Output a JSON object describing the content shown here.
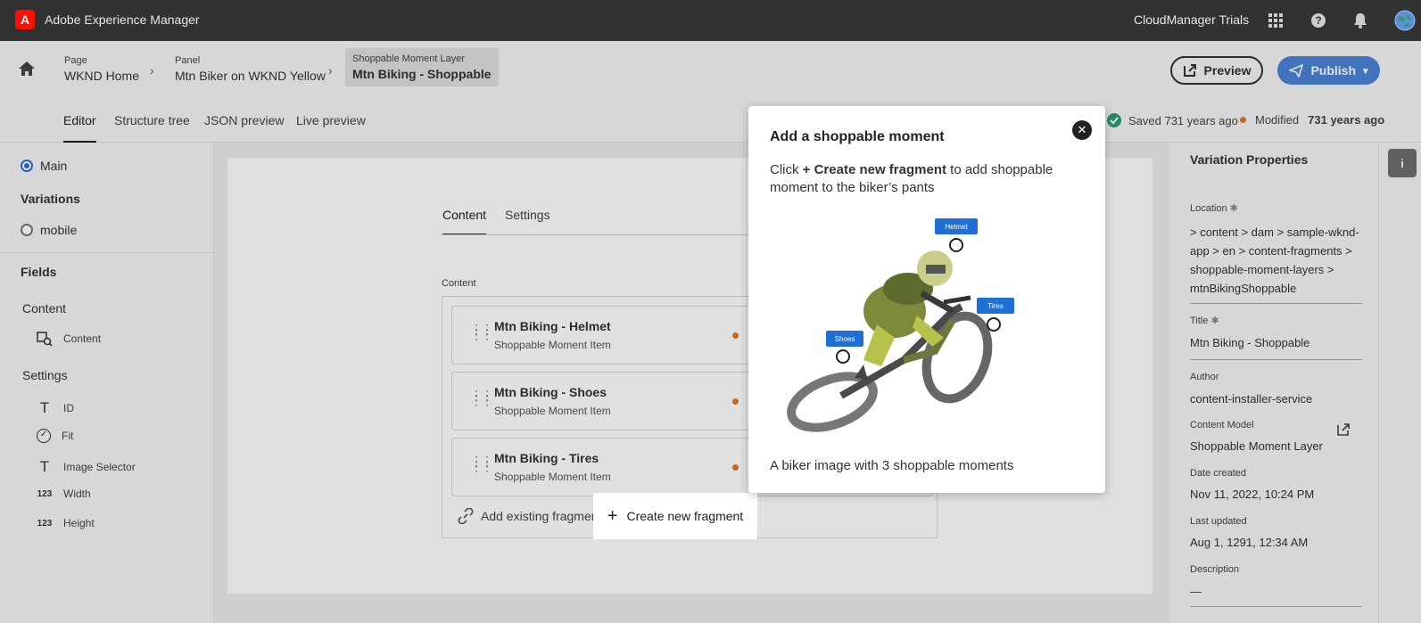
{
  "topbar": {
    "app_title": "Adobe Experience Manager",
    "logo_letter": "A",
    "org": "CloudManager Trials",
    "icons": [
      "apps-grid-icon",
      "help-icon",
      "bell-icon",
      "globe-avatar-icon"
    ]
  },
  "breadcrumbs": [
    {
      "type": "Page",
      "name": "WKND Home"
    },
    {
      "type": "Panel",
      "name": "Mtn Biker on WKND Yellow"
    },
    {
      "type": "Shoppable Moment Layer",
      "name": "Mtn Biking - Shoppable"
    }
  ],
  "actions": {
    "preview_label": "Preview",
    "publish_label": "Publish"
  },
  "tabs": [
    "Editor",
    "Structure tree",
    "JSON preview",
    "Live preview"
  ],
  "status": {
    "saved": "Saved 731 years ago",
    "modified_label": "Modified",
    "modified_value": "731 years ago"
  },
  "left_panel": {
    "main_label": "Main",
    "variations_heading": "Variations",
    "variation_mobile": "mobile",
    "fields_heading": "Fields",
    "content_group": "Content",
    "content_field": "Content",
    "settings_group": "Settings",
    "settings_fields": [
      {
        "icon": "T",
        "label": "ID"
      },
      {
        "icon": "✓",
        "label": "Fit"
      },
      {
        "icon": "T",
        "label": "Image Selector"
      },
      {
        "icon": "123",
        "label": "Width"
      },
      {
        "icon": "123",
        "label": "Height"
      }
    ]
  },
  "editor": {
    "tabs": [
      "Content",
      "Settings"
    ],
    "content_label": "Content",
    "items": [
      {
        "title": "Mtn Biking - Helmet",
        "subtitle": "Shoppable Moment Item"
      },
      {
        "title": "Mtn Biking - Shoes",
        "subtitle": "Shoppable Moment Item"
      },
      {
        "title": "Mtn Biking - Tires",
        "subtitle": "Shoppable Moment Item"
      }
    ],
    "add_existing_label": "Add existing fragment",
    "create_new_label": "Create new fragment"
  },
  "popover": {
    "title": "Add a shoppable moment",
    "body_prefix": "Click ",
    "body_bold": "+ Create new fragment",
    "body_suffix": " to add shoppable moment to the biker’s pants",
    "caption": "A biker image with 3 shoppable moments",
    "hotspots": [
      "Helmet",
      "Tires",
      "Shoes"
    ]
  },
  "right_panel": {
    "title": "Variation Properties",
    "location_label": "Location",
    "location_value": " > content > dam > sample-wknd-app > en > content-fragments > shoppable-moment-layers > mtnBikingShoppable",
    "title_label": "Title",
    "title_value": "Mtn Biking - Shoppable",
    "author_label": "Author",
    "author_value": "content-installer-service",
    "model_label": "Content Model",
    "model_value": "Shoppable Moment Layer",
    "created_label": "Date created",
    "created_value": "Nov 11, 2022, 10:24 PM",
    "updated_label": "Last updated",
    "updated_value": "Aug 1, 1291, 12:34 AM",
    "description_label": "Description",
    "description_value": "—"
  },
  "colors": {
    "accent": "#4a83d6",
    "modified_dot": "#d97a2c",
    "saved_check": "#2d9d78",
    "topbar": "#323232"
  }
}
